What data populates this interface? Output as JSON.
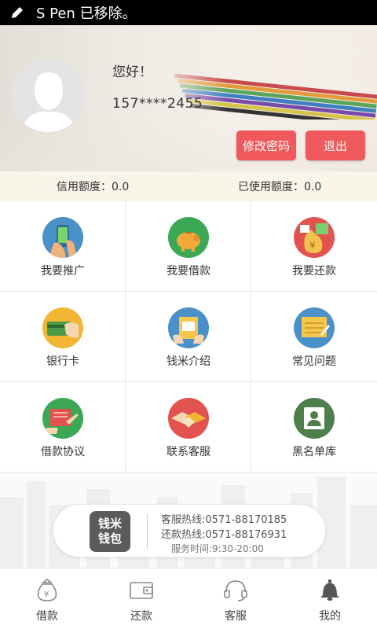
{
  "status_bar": {
    "text": "S Pen 已移除。",
    "icon": "pen-icon"
  },
  "header": {
    "greeting": "您好！",
    "phone": "157****2455",
    "change_password_label": "修改密码",
    "logout_label": "退出"
  },
  "quota": {
    "credit_limit": "信用额度：0.0",
    "used_limit": "已使用额度：0.0"
  },
  "grid": {
    "items": [
      {
        "label": "我要推广",
        "icon": "phone-promote-icon",
        "color": "#4a90c9"
      },
      {
        "label": "我要借款",
        "icon": "piggy-bank-icon",
        "color": "#3aa855"
      },
      {
        "label": "我要还款",
        "icon": "money-bag-icon",
        "color": "#e2524f"
      },
      {
        "label": "银行卡",
        "icon": "bank-card-icon",
        "color": "#f2b632"
      },
      {
        "label": "钱米介绍",
        "icon": "intro-icon",
        "color": "#4a90c9"
      },
      {
        "label": "常见问题",
        "icon": "faq-icon",
        "color": "#4a90c9"
      },
      {
        "label": "借款协议",
        "icon": "agreement-icon",
        "color": "#3aa855"
      },
      {
        "label": "联系客服",
        "icon": "handshake-icon",
        "color": "#e2524f"
      },
      {
        "label": "黑名单库",
        "icon": "blacklist-icon",
        "color": "#4e7e4c"
      }
    ]
  },
  "hotline": {
    "brand": "钱米\n钱包",
    "brand_line1": "钱米",
    "brand_line2": "钱包",
    "service_line": "客服热线:0571-88170185",
    "repay_line": "还款热线:0571-88176931",
    "service_time": "服务时间:9:30-20:00"
  },
  "tabbar": {
    "tabs": [
      {
        "label": "借款",
        "icon": "money-bag-tab-icon"
      },
      {
        "label": "还款",
        "icon": "wallet-tab-icon"
      },
      {
        "label": "客服",
        "icon": "headset-tab-icon"
      },
      {
        "label": "我的",
        "icon": "bell-tab-icon"
      }
    ]
  }
}
